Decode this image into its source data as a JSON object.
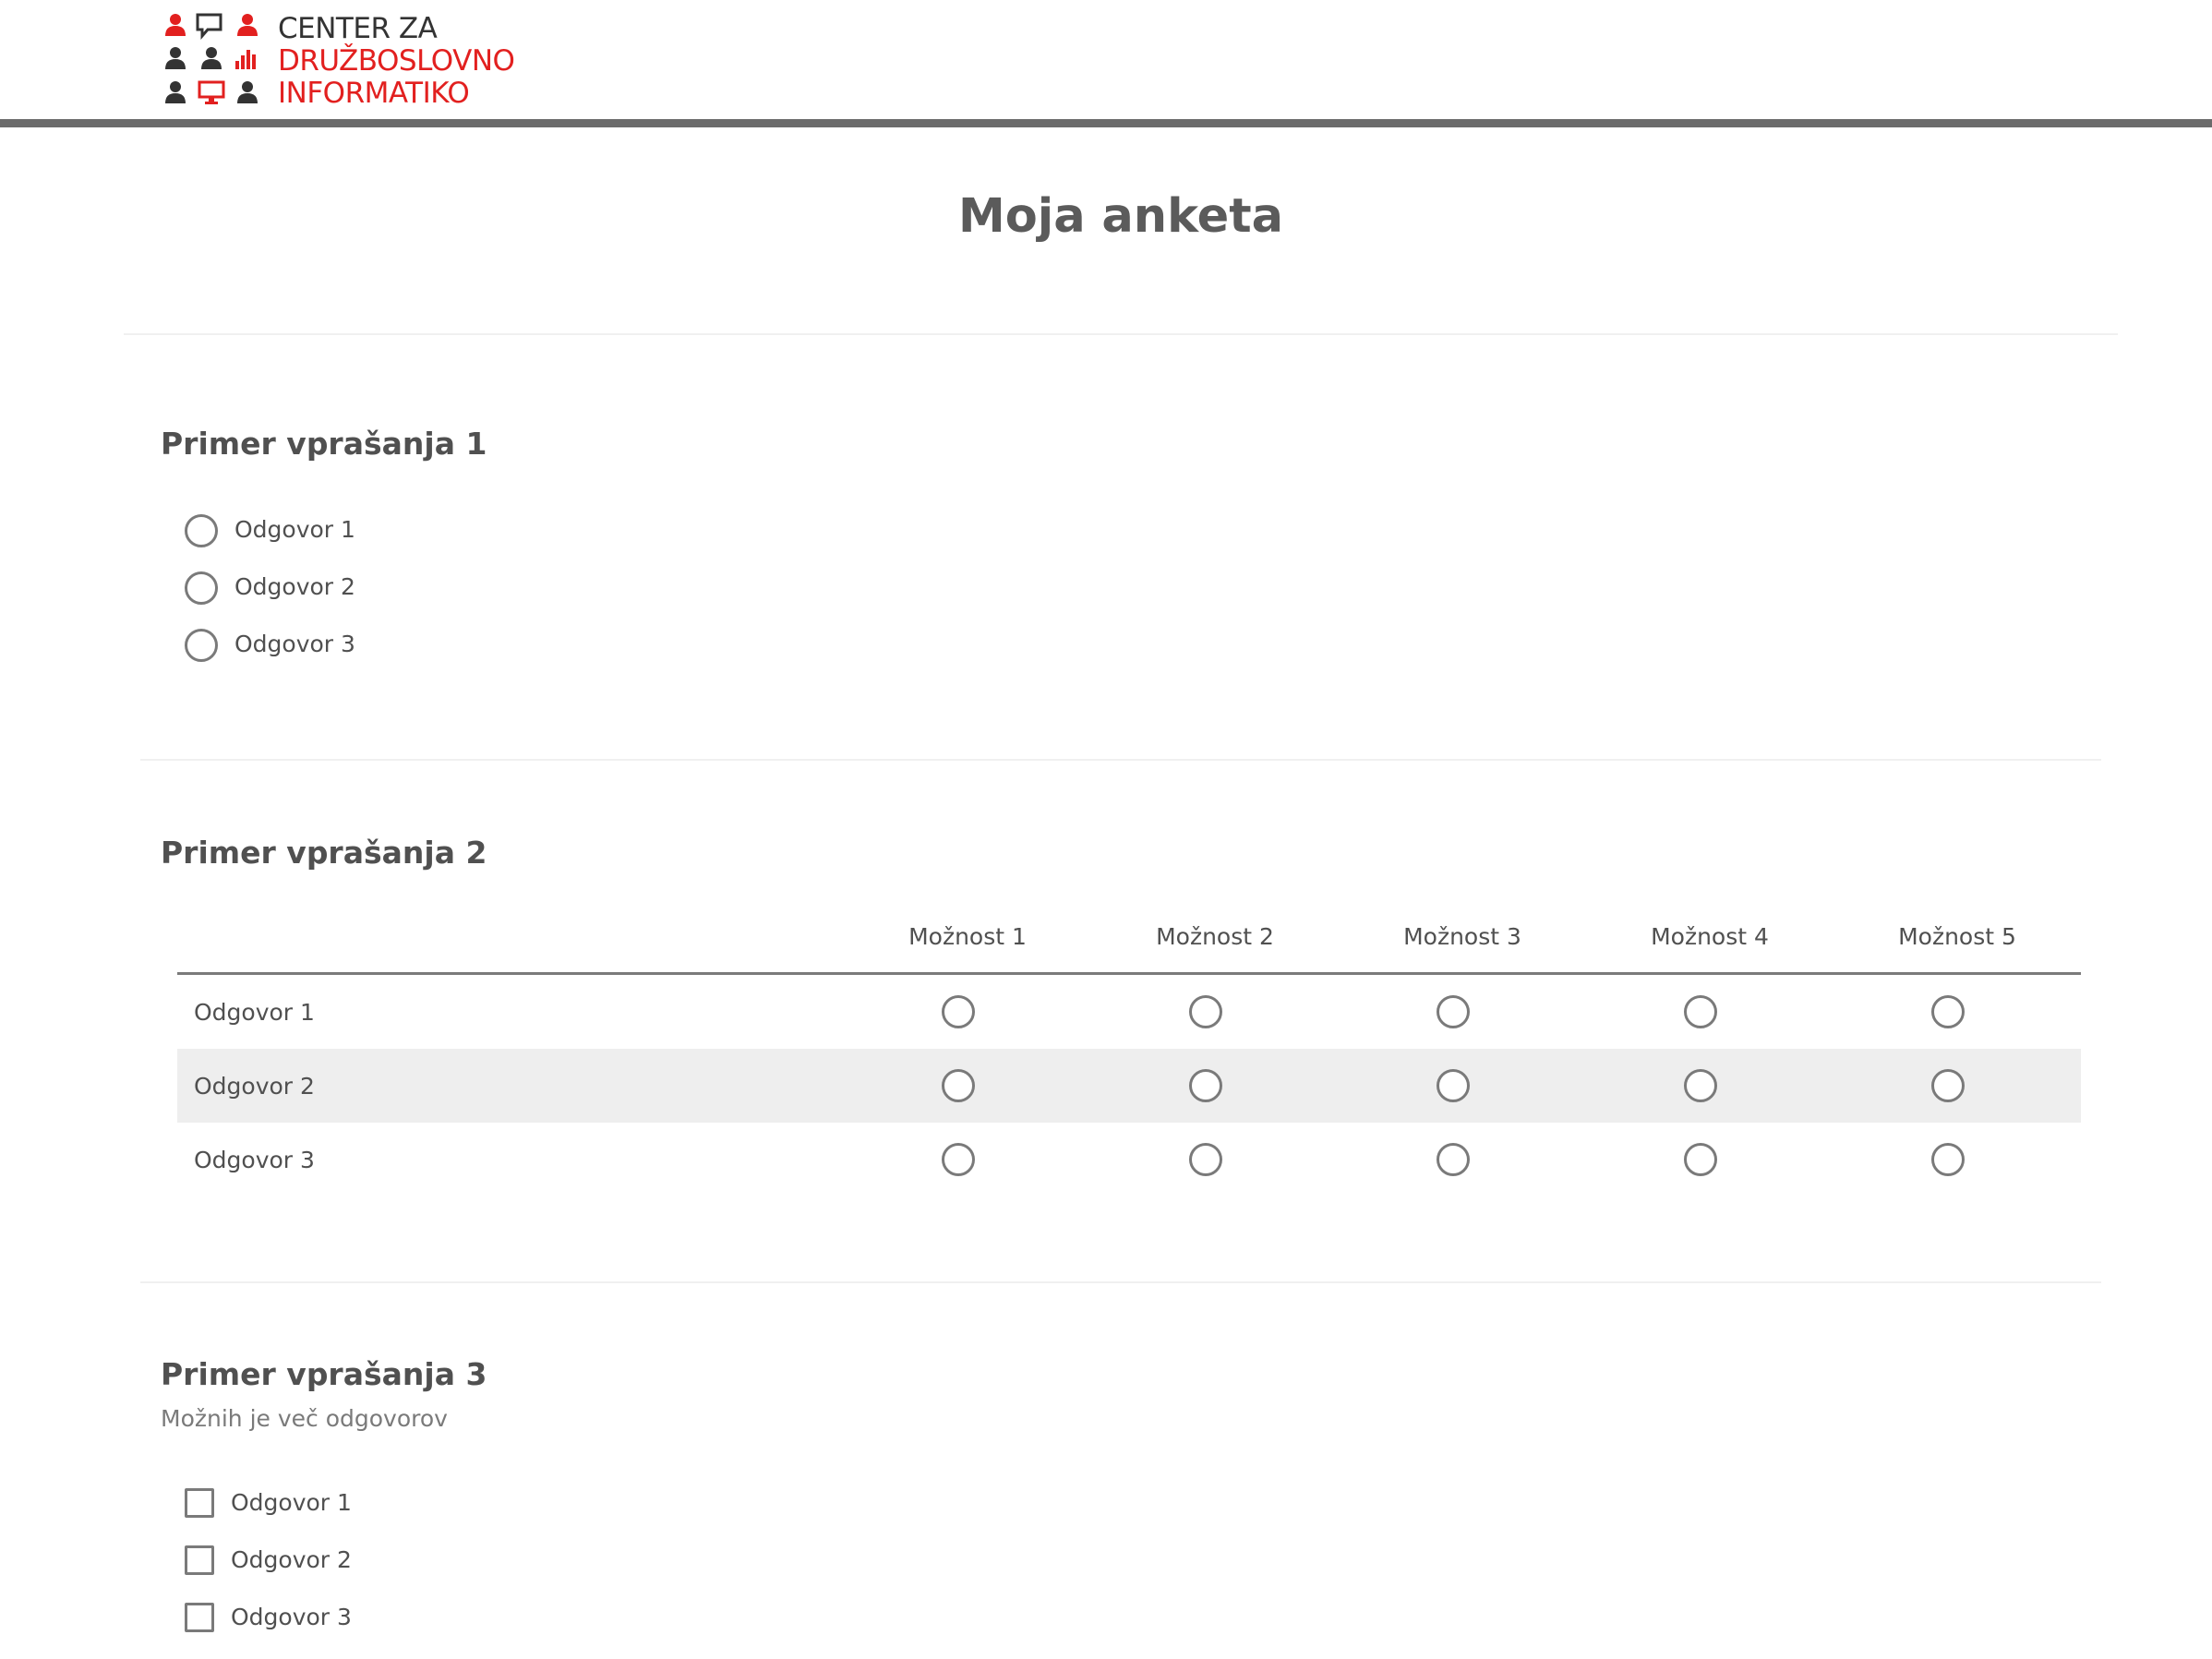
{
  "header": {
    "logo": {
      "line1": "CENTER ZA",
      "line2": "DRUŽBOSLOVNO",
      "line3": "INFORMATIKO",
      "colors": {
        "dark": "#333333",
        "red": "#e2201f"
      }
    }
  },
  "survey": {
    "title": "Moja anketa",
    "q1": {
      "title": "Primer vprašanja 1",
      "type": "radio",
      "options": [
        "Odgovor 1",
        "Odgovor 2",
        "Odgovor 3"
      ]
    },
    "q2": {
      "title": "Primer vprašanja 2",
      "type": "radio-grid",
      "columns": [
        "Možnost 1",
        "Možnost 2",
        "Možnost 3",
        "Možnost 4",
        "Možnost 5"
      ],
      "rows": [
        "Odgovor 1",
        "Odgovor 2",
        "Odgovor 3"
      ]
    },
    "q3": {
      "title": "Primer vprašanja 3",
      "note": "Možnih je več odgovorov",
      "type": "checkbox",
      "options": [
        "Odgovor 1",
        "Odgovor 2",
        "Odgovor 3"
      ]
    }
  },
  "colors": {
    "control_border": "#7a7a7a",
    "header_rule": "#6b6b6b",
    "alt_row": "#eeeeee"
  }
}
